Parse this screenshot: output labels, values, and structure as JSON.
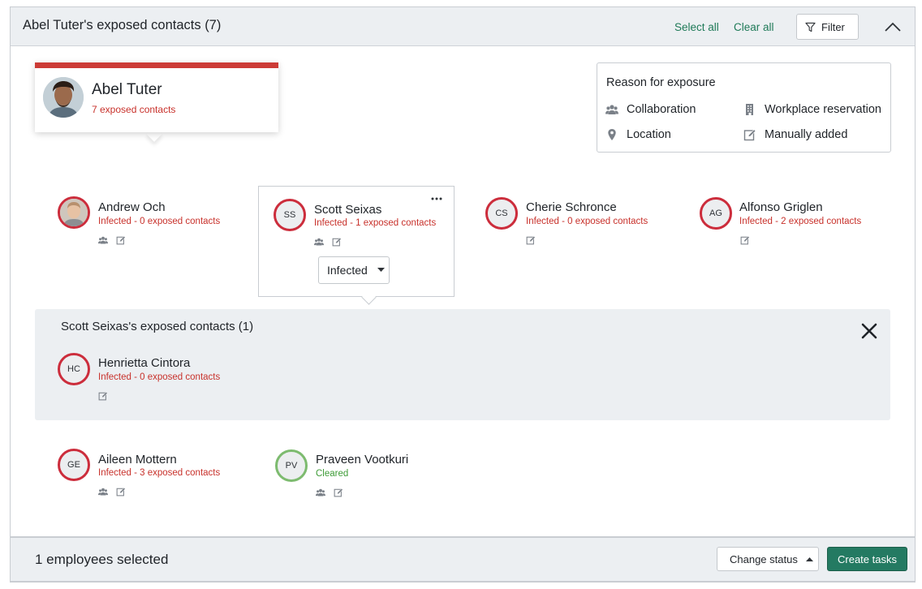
{
  "header": {
    "title": "Abel Tuter's exposed contacts (7)",
    "select_all": "Select all",
    "clear_all": "Clear all",
    "filter_label": "Filter"
  },
  "root": {
    "name": "Abel Tuter",
    "sub": "7 exposed contacts"
  },
  "legend": {
    "title": "Reason for exposure",
    "items": [
      {
        "label": "Collaboration",
        "icon": "collaboration-icon"
      },
      {
        "label": "Workplace reservation",
        "icon": "building-icon"
      },
      {
        "label": "Location",
        "icon": "location-pin-icon"
      },
      {
        "label": "Manually added",
        "icon": "edit-icon"
      }
    ]
  },
  "contacts": [
    {
      "initials": "",
      "name": "Andrew Och",
      "status": "Infected - 0 exposed contacts",
      "icons": [
        "collaboration-icon",
        "edit-icon"
      ]
    },
    {
      "initials": "SS",
      "name": "Scott Seixas",
      "status": "Infected - 1 exposed contacts",
      "icons": [
        "collaboration-icon",
        "edit-icon"
      ],
      "selected": true
    },
    {
      "initials": "CS",
      "name": "Cherie Schronce",
      "status": "Infected - 0 exposed contacts",
      "icons": [
        "edit-icon"
      ]
    },
    {
      "initials": "AG",
      "name": "Alfonso Griglen",
      "status": "Infected - 2 exposed contacts",
      "icons": [
        "edit-icon"
      ]
    },
    {
      "initials": "GE",
      "name": "Aileen Mottern",
      "status": "Infected - 3 exposed contacts",
      "icons": [
        "collaboration-icon",
        "edit-icon"
      ]
    },
    {
      "initials": "PV",
      "name": "Praveen Vootkuri",
      "status": "Cleared",
      "icons": [
        "collaboration-icon",
        "edit-icon"
      ]
    }
  ],
  "selected_card": {
    "status_value": "Infected"
  },
  "subpanel": {
    "title": "Scott Seixas's exposed contacts (1)",
    "contacts": [
      {
        "initials": "HC",
        "name": "Henrietta Cintora",
        "status": "Infected - 0 exposed contacts",
        "icons": [
          "edit-icon"
        ]
      }
    ]
  },
  "footer": {
    "selected_text": "1 employees selected",
    "change_status": "Change status",
    "create_tasks": "Create tasks"
  },
  "colors": {
    "infected": "#cc2d3c",
    "cleared": "#7dbb6f",
    "accent": "#247a62",
    "header_bar": "#cc3b36"
  }
}
